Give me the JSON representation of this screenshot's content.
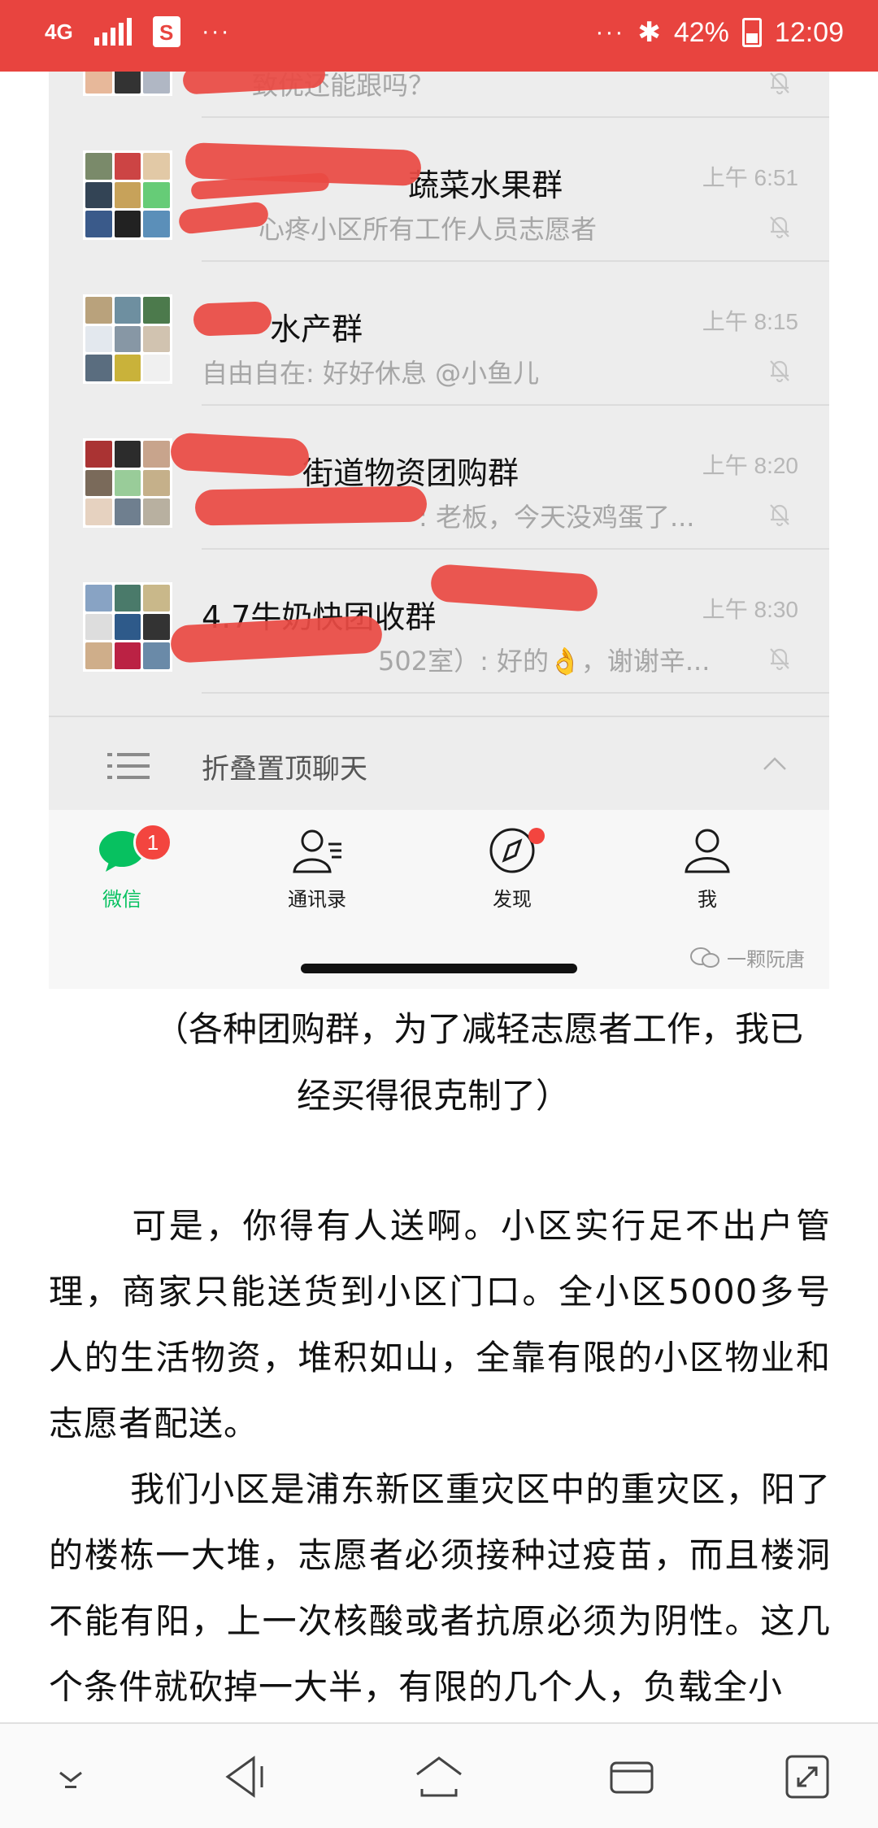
{
  "status_bar": {
    "network": "4G",
    "percentage": "42%",
    "time": "12:09",
    "dots": "···",
    "shopee_glyph": "S"
  },
  "chat_list": {
    "top_partial": {
      "message": "致优还能跟吗？"
    },
    "items": [
      {
        "name": "蔬菜水果群",
        "message": "心疼小区所有工作人员志愿者",
        "time": "上午 6:51"
      },
      {
        "name": "水产群",
        "message": "自由自在: 好好休息 @小鱼儿",
        "time": "上午 8:15"
      },
      {
        "name": "街道物资团购群",
        "message": ": 老板，今天没鸡蛋了...",
        "time": "上午 8:20"
      },
      {
        "name": "4.7牛奶快团收群",
        "message": "502室）: 好的👌，谢谢辛...",
        "time": "上午 8:30"
      }
    ],
    "fold_label": "折叠置顶聊天"
  },
  "tabbar": {
    "tabs": [
      {
        "label": "微信",
        "icon": "chat-bubble-icon",
        "badge": "1"
      },
      {
        "label": "通讯录",
        "icon": "contacts-icon"
      },
      {
        "label": "发现",
        "icon": "compass-icon"
      },
      {
        "label": "我",
        "icon": "person-icon"
      }
    ],
    "accent": "#07c160"
  },
  "watermark": "一颗阮唐",
  "article": {
    "caption_line1": "（各种团购群，为了减轻志愿者工作，我已",
    "caption_line2": "经买得很克制了）",
    "paragraph1": "可是，你得有人送啊。小区实行足不出户管理，商家只能送货到小区门口。全小区5000多号人的生活物资，堆积如山，全靠有限的小区物业和志愿者配送。",
    "paragraph2": "我们小区是浦东新区重灾区中的重灾区，阳了的楼栋一大堆，志愿者必须接种过疫苗，而且楼洞不能有阳，上一次核酸或者抗原必须为阴性。这几个条件就砍掉一大半，有限的几个人，负载全小"
  },
  "colors": {
    "status_bar": "#e8443f",
    "redaction": "#ea4a44"
  }
}
